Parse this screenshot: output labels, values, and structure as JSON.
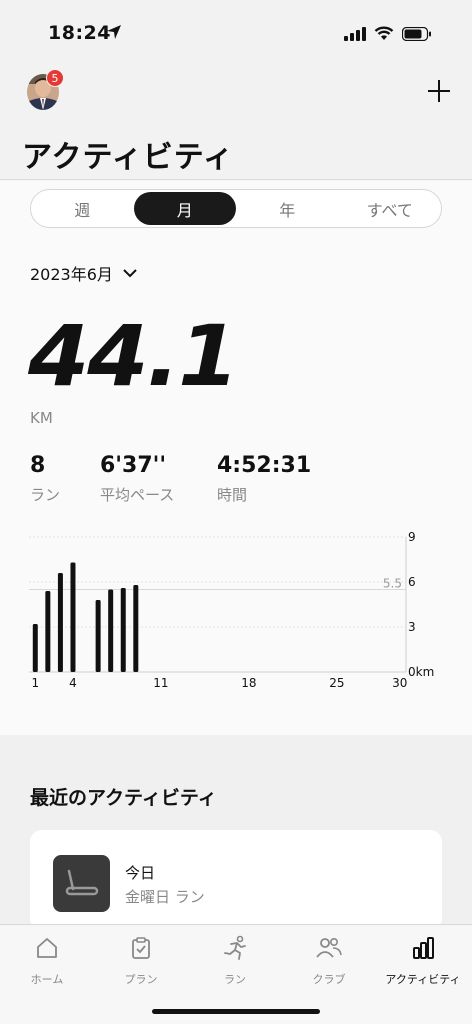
{
  "status": {
    "time": "18:24"
  },
  "header": {
    "badge_count": "5",
    "title": "アクティビティ"
  },
  "segments": [
    {
      "label": "週",
      "active": false
    },
    {
      "label": "月",
      "active": true
    },
    {
      "label": "年",
      "active": false
    },
    {
      "label": "すべて",
      "active": false
    }
  ],
  "summary": {
    "month": "2023年6月",
    "distance": "44.1",
    "unit": "KM",
    "stats": [
      {
        "value": "8",
        "label": "ラン"
      },
      {
        "value": "6'37''",
        "label": "平均ペース"
      },
      {
        "value": "4:52:31",
        "label": "時間"
      }
    ]
  },
  "chart_data": {
    "type": "bar",
    "x": [
      1,
      2,
      3,
      4,
      6,
      7,
      8,
      9
    ],
    "values": [
      3.2,
      5.4,
      6.6,
      7.3,
      4.8,
      5.5,
      5.6,
      5.8
    ],
    "ylim": [
      0,
      9
    ],
    "yticks": [
      "9",
      "6",
      "3",
      "0km"
    ],
    "xticks": [
      "1",
      "4",
      "11",
      "18",
      "25",
      "30"
    ],
    "average_label": "5.5",
    "average": 5.5,
    "days_in_month": 30,
    "grid": true
  },
  "recent": {
    "title": "最近のアクティビティ",
    "item": {
      "date": "今日",
      "subtitle": "金曜日 ラン",
      "icon": "treadmill-icon"
    }
  },
  "tabs": [
    {
      "label": "ホーム",
      "icon": "home-icon",
      "active": false
    },
    {
      "label": "プラン",
      "icon": "clipboard-icon",
      "active": false
    },
    {
      "label": "ラン",
      "icon": "runner-icon",
      "active": false
    },
    {
      "label": "クラブ",
      "icon": "people-icon",
      "active": false
    },
    {
      "label": "アクティビティ",
      "icon": "bar-chart-icon",
      "active": true
    }
  ]
}
